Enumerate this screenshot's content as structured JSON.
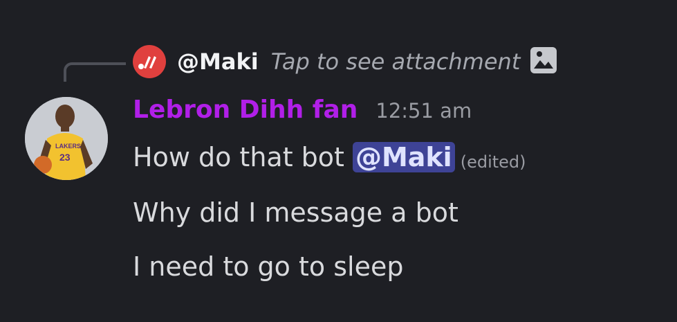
{
  "reply": {
    "mention_name": "@Maki",
    "preview_text": "Tap to see attachment",
    "avatar_icon": "maki-logo-icon",
    "attachment_icon": "image-icon",
    "avatar_color": "#e0403e"
  },
  "message": {
    "author": "Lebron Dihh fan",
    "author_color": "#b11fe8",
    "timestamp": "12:51 am",
    "avatar_icon": "user-avatar-photo",
    "lines": [
      {
        "text": "How do that bot",
        "mention": "@Maki",
        "edited": "(edited)"
      },
      {
        "text": "Why did I message a bot"
      },
      {
        "text": "I need to go to sleep"
      }
    ]
  },
  "colors": {
    "background": "#1e1f24",
    "mention_bg": "#3e4396",
    "text": "#d9dadd"
  }
}
